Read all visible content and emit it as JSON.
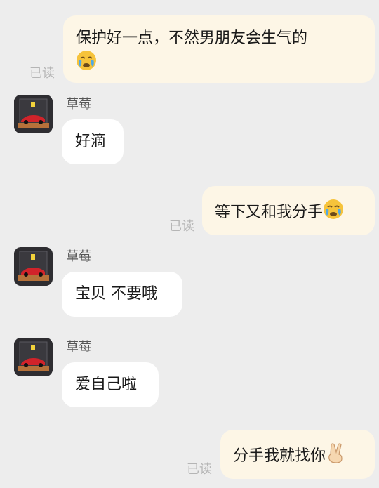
{
  "messages": [
    {
      "side": "sent",
      "text": "保护好一点，不然男朋友会生气的",
      "emoji": "crying-face",
      "read": "已读"
    },
    {
      "side": "recv",
      "sender": "草莓",
      "text": "好滴",
      "avatar": "ferrari-model-avatar"
    },
    {
      "side": "sent",
      "text": "等下又和我分手",
      "emoji": "crying-face",
      "read": "已读"
    },
    {
      "side": "recv",
      "sender": "草莓",
      "text": "宝贝 不要哦",
      "avatar": "ferrari-model-avatar"
    },
    {
      "side": "recv",
      "sender": "草莓",
      "text": "爱自己啦",
      "avatar": "ferrari-model-avatar"
    },
    {
      "side": "sent",
      "text": "分手我就找你",
      "emoji": "victory-hand",
      "read": "已读"
    }
  ],
  "colors": {
    "background": "#ededed",
    "sent_bubble": "#fdf6e6",
    "recv_bubble": "#ffffff",
    "read_text": "#b5b5b5"
  }
}
